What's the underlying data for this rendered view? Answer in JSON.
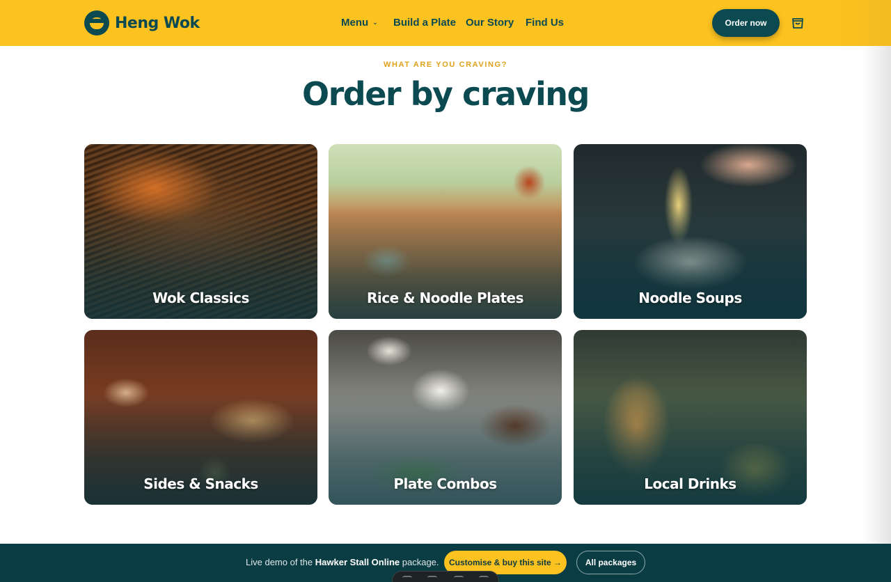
{
  "header": {
    "brand_name": "Heng Wok",
    "nav": [
      {
        "label": "Menu"
      },
      {
        "label": "Build a Plate"
      },
      {
        "label": "Our Story"
      },
      {
        "label": "Find Us"
      }
    ],
    "order_button": "Order now",
    "cart_icon": "shopping-bag-icon"
  },
  "section": {
    "eyebrow": "WHAT ARE YOU CRAVING?",
    "title": "Order by craving"
  },
  "categories": [
    {
      "label": "Wok Classics"
    },
    {
      "label": "Rice & Noodle Plates"
    },
    {
      "label": "Noodle Soups"
    },
    {
      "label": "Sides & Snacks"
    },
    {
      "label": "Plate Combos"
    },
    {
      "label": "Local Drinks"
    }
  ],
  "demo_bar": {
    "text_prefix": "Live demo of the",
    "package_name": "Hawker Stall Online",
    "text_suffix": "package.",
    "buy_button": "Customise & buy this site →",
    "packages_button": "All packages"
  },
  "colors": {
    "brand_yellow": "#fcc21f",
    "brand_teal": "#0c4a52",
    "accent_gold": "#e0a21a",
    "footer_bg": "#0a3c43"
  }
}
